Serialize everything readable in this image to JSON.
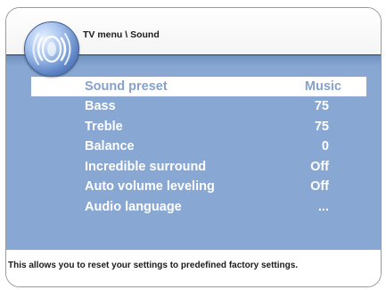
{
  "header": {
    "breadcrumb": "TV menu \\ Sound",
    "logo_icon": "speaker-icon"
  },
  "menu": {
    "items": [
      {
        "label": "Sound preset",
        "value": "Music",
        "selected": true
      },
      {
        "label": "Bass",
        "value": "75",
        "selected": false
      },
      {
        "label": "Treble",
        "value": "75",
        "selected": false
      },
      {
        "label": "Balance",
        "value": "0",
        "selected": false
      },
      {
        "label": "Incredible surround",
        "value": "Off",
        "selected": false
      },
      {
        "label": "Auto volume leveling",
        "value": "Off",
        "selected": false
      },
      {
        "label": "Audio language",
        "value": "...",
        "selected": false
      }
    ]
  },
  "footer": {
    "description": "This allows you to reset your settings to predefined factory settings."
  },
  "colors": {
    "panel": "#88a7d2",
    "selected_background": "#ffffff",
    "selected_text": "#86a1cc",
    "item_text": "#ffffff"
  }
}
